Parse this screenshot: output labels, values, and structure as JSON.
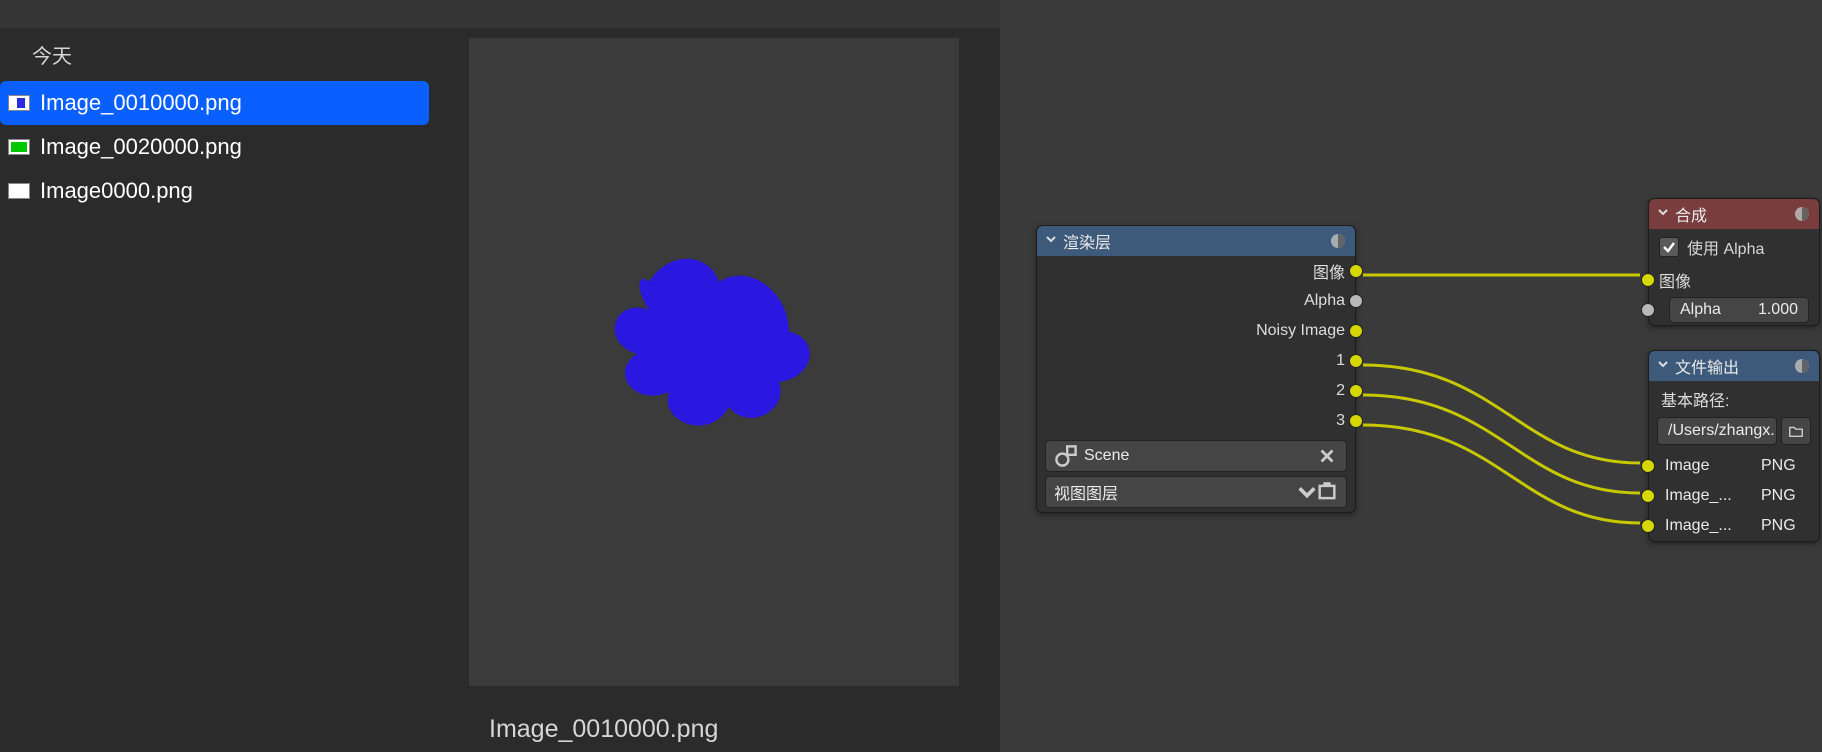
{
  "file_browser": {
    "section_label": "今天",
    "items": [
      {
        "name": "Image_0010000.png",
        "selected": true,
        "thumb": "blue"
      },
      {
        "name": "Image_0020000.png",
        "selected": false,
        "thumb": "green"
      },
      {
        "name": "Image0000.png",
        "selected": false,
        "thumb": "white"
      }
    ]
  },
  "preview": {
    "filename": "Image_0010000.png"
  },
  "nodes": {
    "render_layers": {
      "title": "渲染层",
      "outputs": [
        "图像",
        "Alpha",
        "Noisy Image",
        "1",
        "2",
        "3"
      ],
      "scene_field": "Scene",
      "viewlayer_field": "视图图层"
    },
    "composite": {
      "title": "合成",
      "use_alpha_label": "使用 Alpha",
      "use_alpha_checked": true,
      "inputs": {
        "image_label": "图像",
        "alpha_label": "Alpha",
        "alpha_value": "1.000"
      }
    },
    "file_output": {
      "title": "文件输出",
      "base_path_label": "基本路径:",
      "base_path_value": "/Users/zhangx...",
      "outputs": [
        {
          "name": "Image",
          "format": "PNG"
        },
        {
          "name": "Image_...",
          "format": "PNG"
        },
        {
          "name": "Image_...",
          "format": "PNG"
        }
      ]
    }
  }
}
